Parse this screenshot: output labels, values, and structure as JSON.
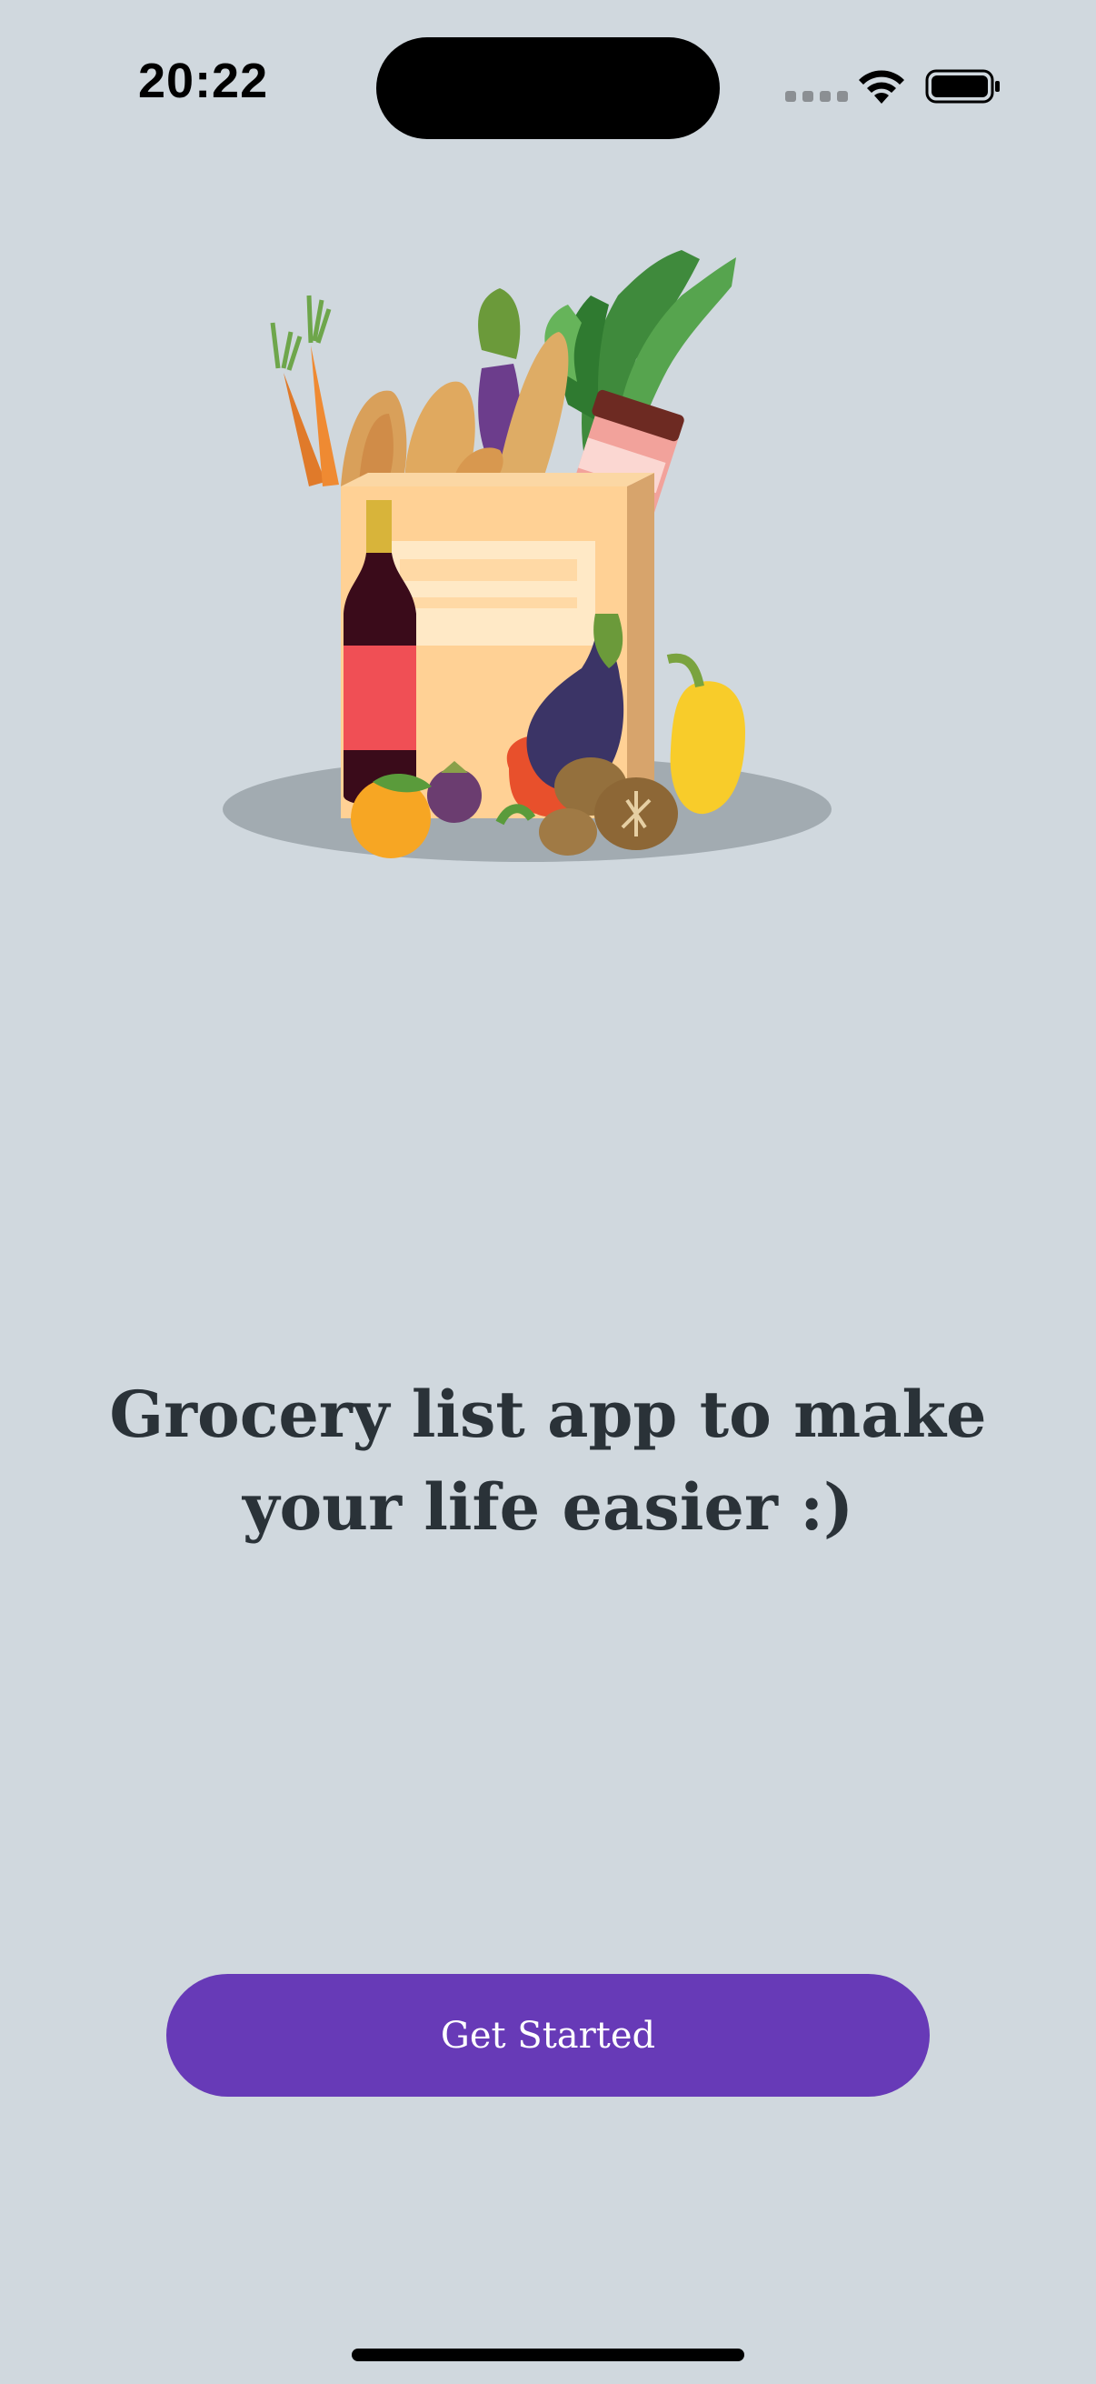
{
  "status_bar": {
    "time": "20:22"
  },
  "onboarding": {
    "illustration": "grocery-bag-illustration",
    "headline": "Grocery list app to make your life easier :)",
    "cta_label": "Get Started"
  },
  "colors": {
    "background": "#d0d8de",
    "accent": "#673ab7",
    "headline": "#2a3238",
    "cta_text": "#ffffff"
  }
}
